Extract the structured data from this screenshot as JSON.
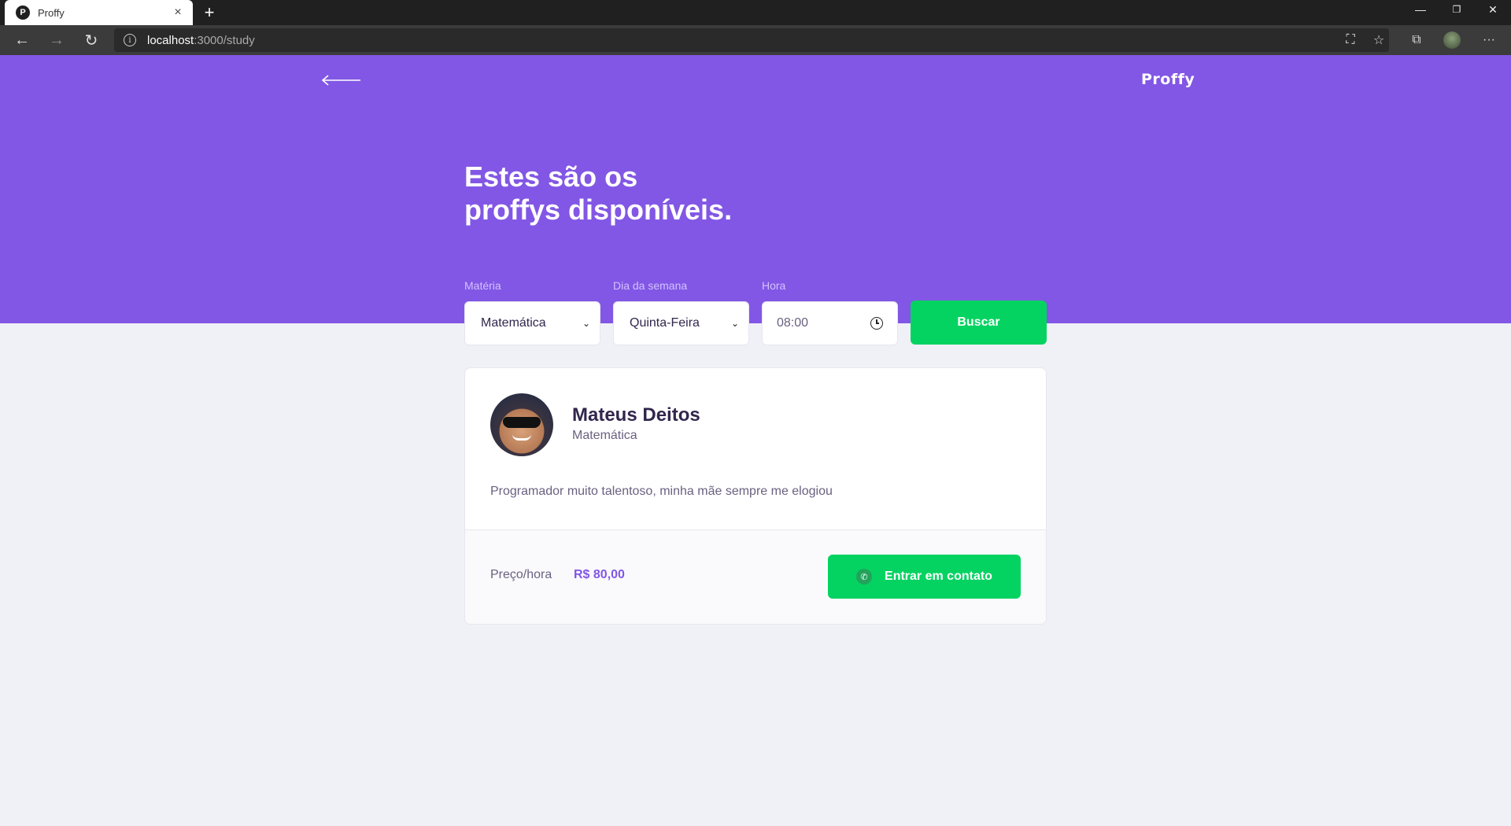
{
  "browser": {
    "tab_title": "Proffy",
    "tab_favicon_letter": "P",
    "close_glyph": "×",
    "new_tab_glyph": "+",
    "window": {
      "minimize": "—",
      "restore": "❐",
      "close": "✕"
    },
    "nav": {
      "back": "←",
      "forward": "→",
      "reload": "↻"
    },
    "url_host": "localhost",
    "url_path": ":3000/study",
    "info_glyph": "i",
    "toolbar": {
      "read_aloud": "⛶",
      "favorite": "☆",
      "collections": "⧉",
      "more": "···"
    }
  },
  "header": {
    "brand": "Proffy",
    "title_line1": "Estes são os",
    "title_line2": "proffys disponíveis."
  },
  "filters": {
    "subject_label": "Matéria",
    "subject_value": "Matemática",
    "weekday_label": "Dia da semana",
    "weekday_value": "Quinta-Feira",
    "time_label": "Hora",
    "time_value": "08:00",
    "chevron": "⌄",
    "search_label": "Buscar"
  },
  "teacher": {
    "name": "Mateus Deitos",
    "subject": "Matemática",
    "bio": "Programador muito talentoso, minha mãe sempre me elogiou",
    "price_label": "Preço/hora",
    "price_value": "R$ 80,00",
    "contact_label": "Entrar em contato",
    "contact_icon": "✆"
  },
  "colors": {
    "primary": "#8257e5",
    "secondary": "#04d361",
    "background": "#f0f0f7"
  }
}
